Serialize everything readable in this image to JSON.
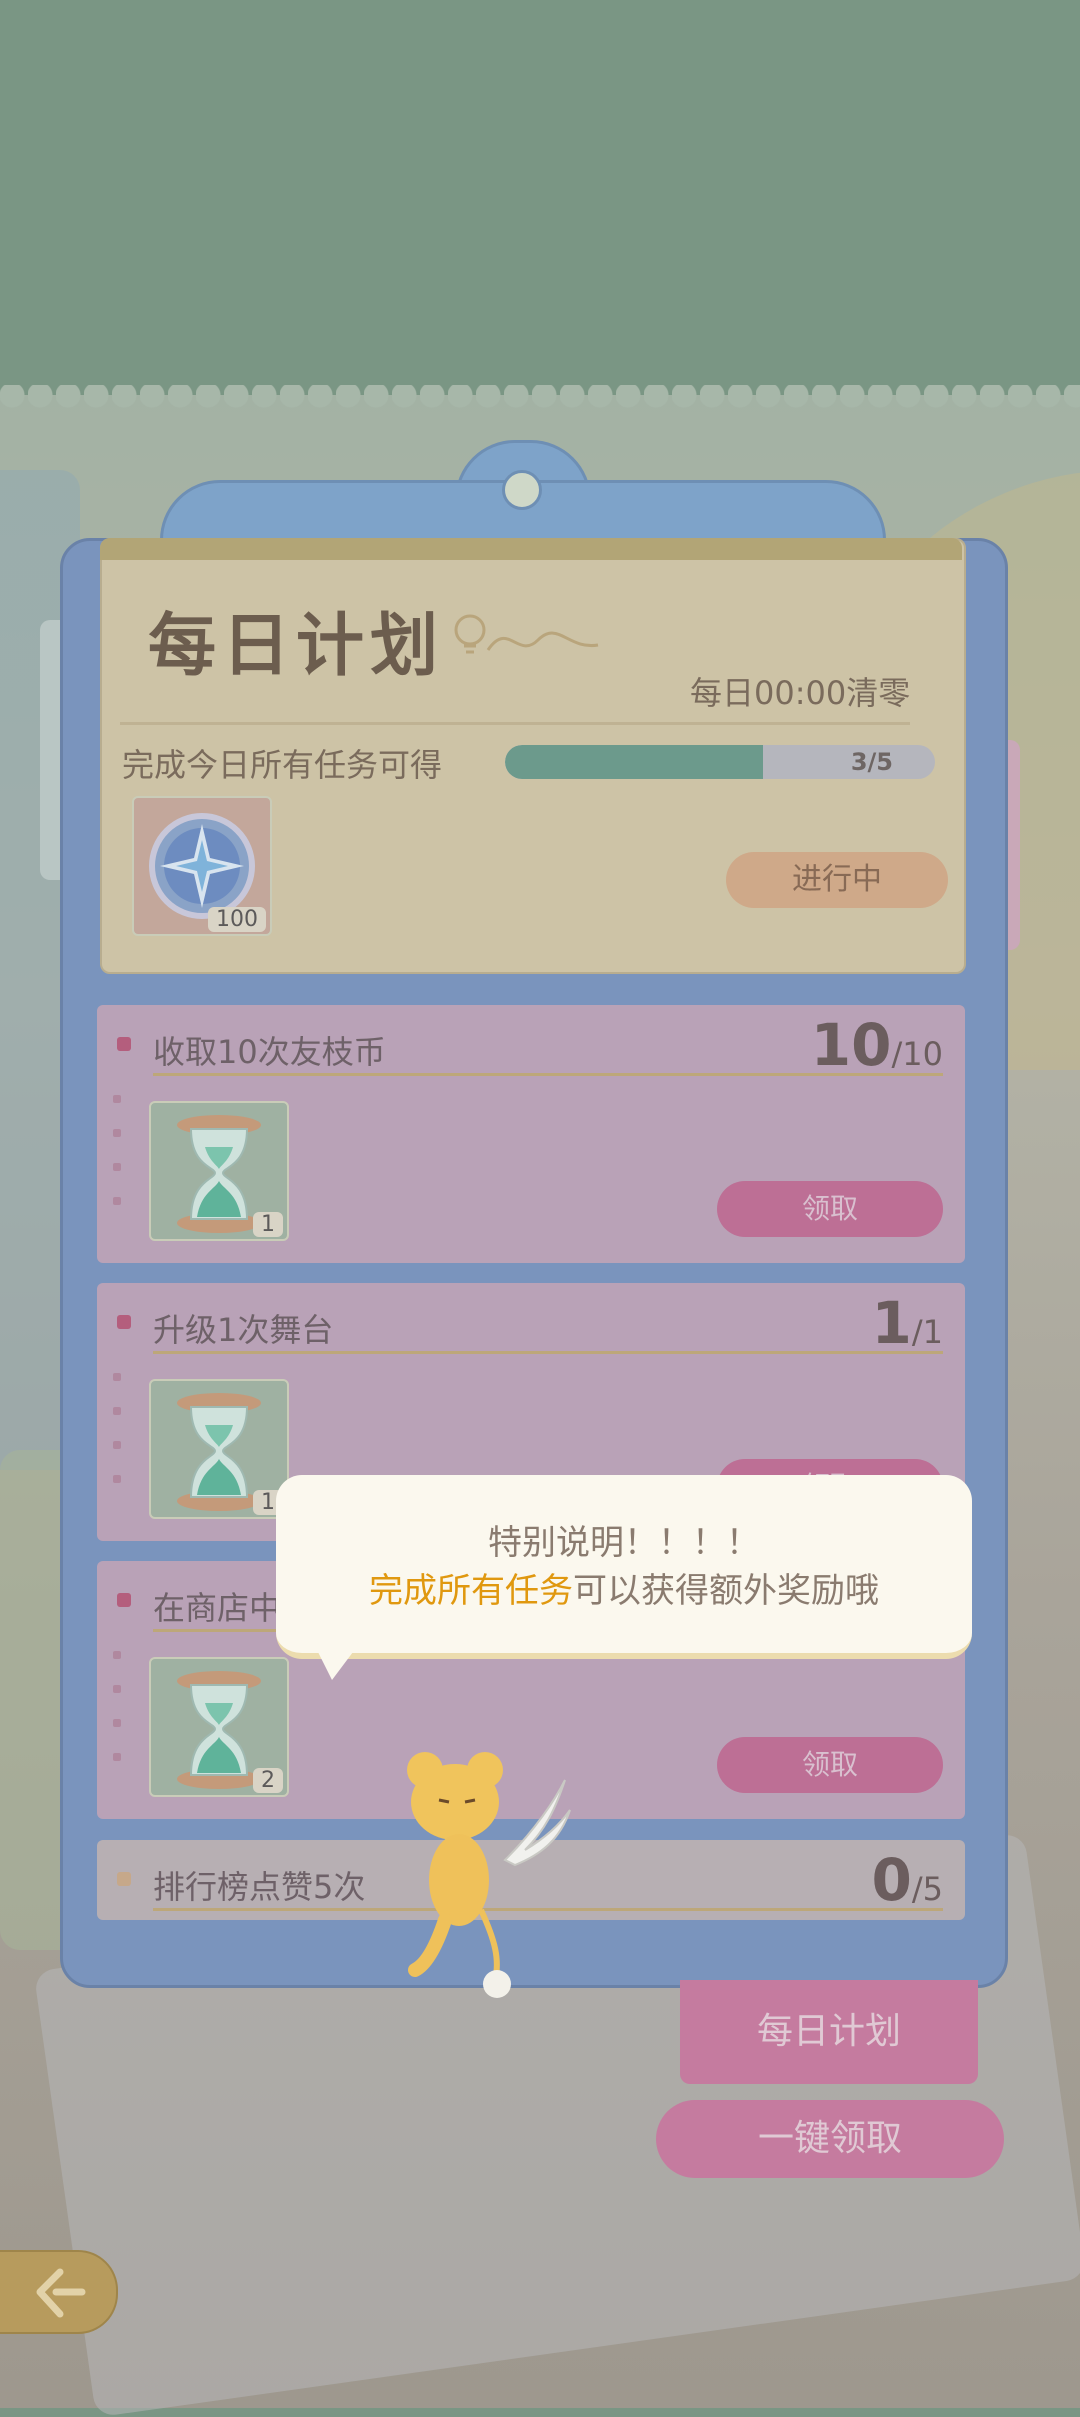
{
  "header": {
    "title": "每日计划",
    "reset_note": "每日00:00清零",
    "reward_desc": "完成今日所有任务可得",
    "progress": {
      "done": 3,
      "total": 5,
      "text": "3/5"
    },
    "reward_qty": "100",
    "status": "进行中"
  },
  "tasks": [
    {
      "name": "收取10次友枝币",
      "count": "10",
      "total": "/10",
      "item_qty": "1",
      "button": "领取"
    },
    {
      "name": "升级1次舞台",
      "count": "1",
      "total": "/1",
      "item_qty": "1",
      "button": "领取"
    },
    {
      "name": "在商店中",
      "count": "",
      "total": "",
      "item_qty": "2",
      "button": "领取"
    },
    {
      "name": "排行榜点赞5次",
      "count": "0",
      "total": "/5"
    }
  ],
  "bubble": {
    "line1": "特别说明！！！！",
    "line2_highlight": "完成所有任务",
    "line2_rest": "可以获得额外奖励哦"
  },
  "bottom": {
    "daily_plan": "每日计划",
    "claim_all": "一键领取"
  },
  "colors": {
    "accent": "#c57b9f",
    "board": "#7a94bd",
    "progress": "#6c9a8c",
    "highlight": "#e0980f"
  }
}
